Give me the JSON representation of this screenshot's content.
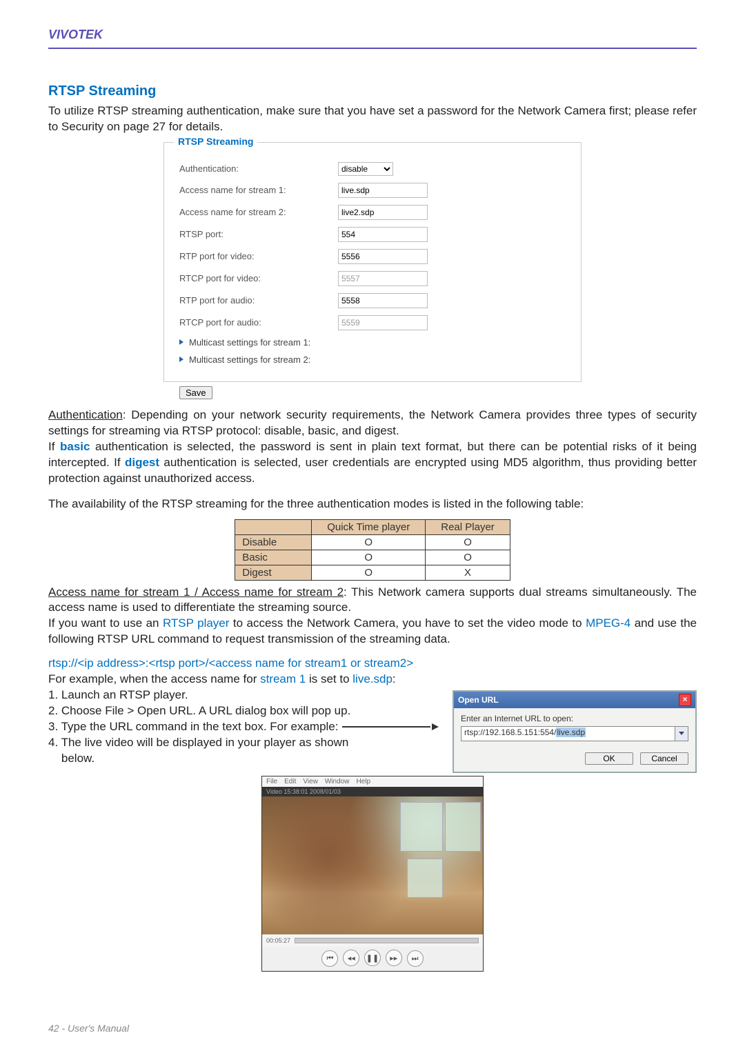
{
  "brand": "VIVOTEK",
  "section_title": "RTSP Streaming",
  "intro": "To utilize RTSP streaming authentication, make sure that you have set a password for the Network Camera first; please refer to Security on page 27 for details.",
  "config": {
    "legend": "RTSP Streaming",
    "auth_label": "Authentication:",
    "auth_value": "disable",
    "stream1_label": "Access name for stream 1:",
    "stream1_value": "live.sdp",
    "stream2_label": "Access name for stream 2:",
    "stream2_value": "live2.sdp",
    "rtsp_port_label": "RTSP port:",
    "rtsp_port_value": "554",
    "rtp_video_label": "RTP port for video:",
    "rtp_video_value": "5556",
    "rtcp_video_label": "RTCP port for video:",
    "rtcp_video_value": "5557",
    "rtp_audio_label": "RTP port for audio:",
    "rtp_audio_value": "5558",
    "rtcp_audio_label": "RTCP port for audio:",
    "rtcp_audio_value": "5559",
    "mcast1": "Multicast settings for stream 1:",
    "mcast2": "Multicast settings for stream 2:",
    "save": "Save"
  },
  "auth_para_lead": "Authentication",
  "auth_para_rest": ": Depending on your network security requirements, the Network Camera provides three types of security settings for streaming via RTSP protocol: disable, basic, and digest.",
  "basic_pre": "If ",
  "basic_word": "basic",
  "basic_mid": " authentication is selected, the password is sent in plain text format, but there can be potential risks of it being intercepted. If ",
  "digest_word": "digest",
  "digest_post": " authentication is selected, user credentials are encrypted using MD5 algorithm, thus providing better protection against unauthorized access.",
  "avail_sentence": "The availability of the RTSP streaming for the three authentication modes is listed in the following table:",
  "table": {
    "cols": [
      "",
      "Quick Time player",
      "Real Player"
    ],
    "rows": [
      {
        "h": "Disable",
        "c1": "O",
        "c2": "O"
      },
      {
        "h": "Basic",
        "c1": "O",
        "c2": "O"
      },
      {
        "h": "Digest",
        "c1": "O",
        "c2": "X"
      }
    ]
  },
  "access_lead": "Access name for stream 1 / Access name for stream 2",
  "access_rest": ": This Network camera supports dual streams simultaneously. The access name is used to differentiate the streaming source.",
  "rtsp_player_pre": "If you want to use an ",
  "rtsp_player_link": "RTSP player",
  "rtsp_player_mid": " to access the Network Camera, you have to set the video mode to ",
  "mpeg4_link": "MPEG-4",
  "rtsp_player_post": " and use the following RTSP URL command to request transmission of the streaming data.",
  "url_template": "rtsp://<ip address>:<rtsp port>/<access name for stream1 or stream2>",
  "example_pre": "For example, when the access name for ",
  "example_stream": "stream 1",
  "example_mid": " is set to ",
  "example_livesdp": "live.sdp",
  "example_post": ":",
  "steps": {
    "s1": "1. Launch an RTSP player.",
    "s2": "2. Choose File > Open URL. A URL dialog box will pop up.",
    "s3": "3. Type the URL command in the text box. For example:",
    "s4a": "4. The live video will be displayed in your player as shown",
    "s4b": "    below."
  },
  "dialog": {
    "title": "Open URL",
    "label": "Enter an Internet URL to open:",
    "value_pre": "rtsp://192.168.5.151:554/",
    "value_hl": "live.sdp",
    "ok": "OK",
    "cancel": "Cancel"
  },
  "player": {
    "menus": [
      "File",
      "Edit",
      "View",
      "Window",
      "Help"
    ],
    "timestamp": "Video 15:38:01 2008/01/03",
    "time": "00:05:27"
  },
  "footer": "42 - User's Manual"
}
